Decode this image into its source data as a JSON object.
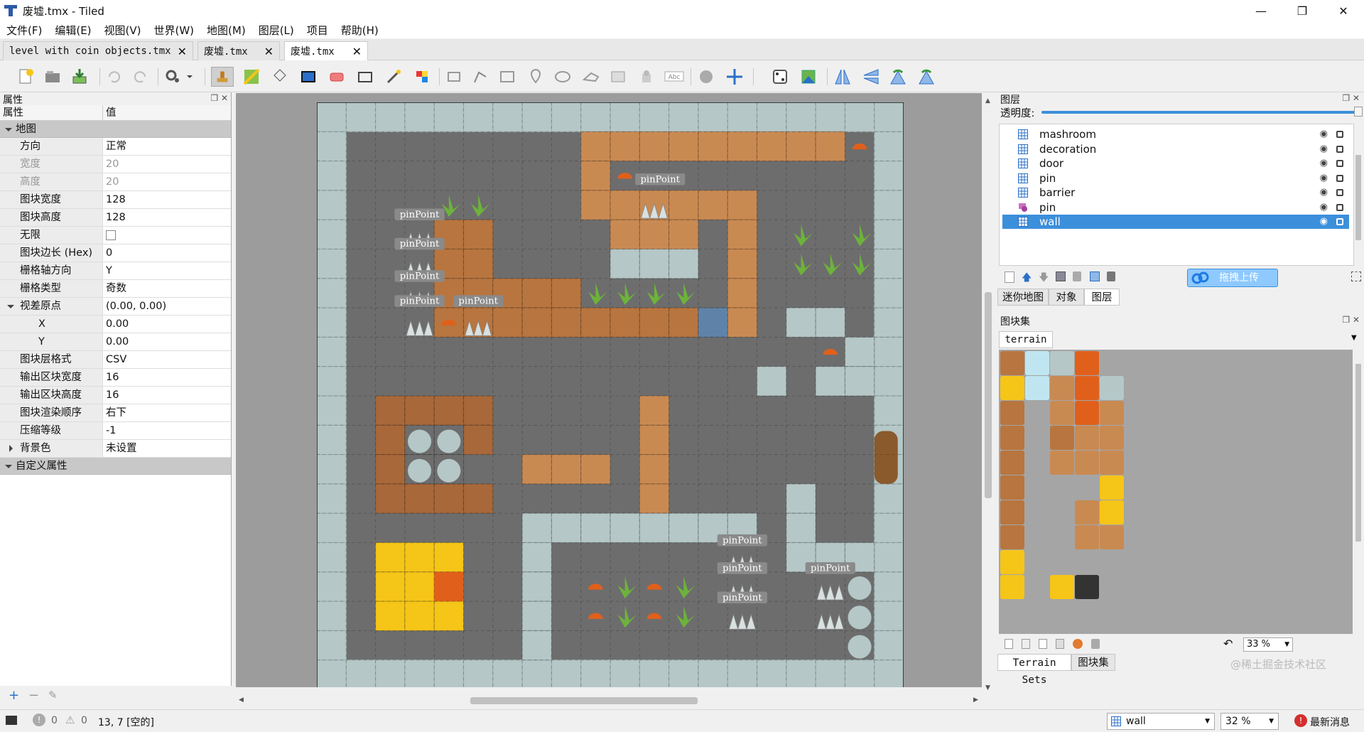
{
  "window": {
    "title": "废墟.tmx - Tiled"
  },
  "menu": [
    "文件(F)",
    "编辑(E)",
    "视图(V)",
    "世界(W)",
    "地图(M)",
    "图层(L)",
    "项目",
    "帮助(H)"
  ],
  "tabs": [
    {
      "label": "level with coin objects.tmx",
      "active": false
    },
    {
      "label": "废墟.tmx",
      "active": false
    },
    {
      "label": "废墟.tmx",
      "active": true
    }
  ],
  "properties": {
    "title": "属性",
    "col_name": "属性",
    "col_value": "值",
    "group_map": "地图",
    "rows": [
      {
        "key": "方向",
        "value": "正常",
        "disabled": false
      },
      {
        "key": "宽度",
        "value": "20",
        "disabled": true
      },
      {
        "key": "高度",
        "value": "20",
        "disabled": true
      },
      {
        "key": "图块宽度",
        "value": "128",
        "disabled": false
      },
      {
        "key": "图块高度",
        "value": "128",
        "disabled": false
      },
      {
        "key": "无限",
        "value": "",
        "disabled": false,
        "checkbox": true
      },
      {
        "key": "图块边长 (Hex)",
        "value": "0",
        "disabled": false
      },
      {
        "key": "栅格轴方向",
        "value": "Y",
        "disabled": false
      },
      {
        "key": "栅格类型",
        "value": "奇数",
        "disabled": false
      },
      {
        "key": "视差原点",
        "value": "(0.00, 0.00)",
        "disabled": false,
        "expand": "down"
      },
      {
        "key": "X",
        "value": "0.00",
        "disabled": false,
        "sub": true
      },
      {
        "key": "Y",
        "value": "0.00",
        "disabled": false,
        "sub": true
      },
      {
        "key": "图块层格式",
        "value": "CSV",
        "disabled": false
      },
      {
        "key": "输出区块宽度",
        "value": "16",
        "disabled": false
      },
      {
        "key": "输出区块高度",
        "value": "16",
        "disabled": false
      },
      {
        "key": "图块渲染顺序",
        "value": "右下",
        "disabled": false
      },
      {
        "key": "压缩等级",
        "value": "-1",
        "disabled": false
      },
      {
        "key": "背景色",
        "value": "未设置",
        "disabled": false,
        "expand": "right"
      }
    ],
    "group_custom": "自定义属性"
  },
  "layers_panel": {
    "title": "图层",
    "opacity_label": "透明度:",
    "opacity": 1.0,
    "layers": [
      {
        "name": "mashroom",
        "type": "tile",
        "selected": false
      },
      {
        "name": "decoration",
        "type": "tile",
        "selected": false
      },
      {
        "name": "door",
        "type": "tile",
        "selected": false
      },
      {
        "name": "pin",
        "type": "tile",
        "selected": false
      },
      {
        "name": "barrier",
        "type": "tile",
        "selected": false
      },
      {
        "name": "pin",
        "type": "object",
        "selected": false
      },
      {
        "name": "wall",
        "type": "tile",
        "selected": true
      }
    ],
    "upload_button": "拖拽上传",
    "tabs": [
      "迷你地图",
      "对象",
      "图层"
    ],
    "active_tab": "图层"
  },
  "tilesets_panel": {
    "title": "图块集",
    "tileset_tab": "terrain",
    "zoom": "33 %",
    "bottom_tabs": [
      "Terrain Sets",
      "图块集"
    ],
    "active_bottom_tab": "图块集"
  },
  "map": {
    "object_label": "pinPoint"
  },
  "status": {
    "errors": "0",
    "warnings": "0",
    "position": "13, 7 [空的]",
    "layer_select": "wall",
    "zoom_select": "32 %",
    "news": "最新消息",
    "watermark": "@稀土掘金技术社区"
  }
}
